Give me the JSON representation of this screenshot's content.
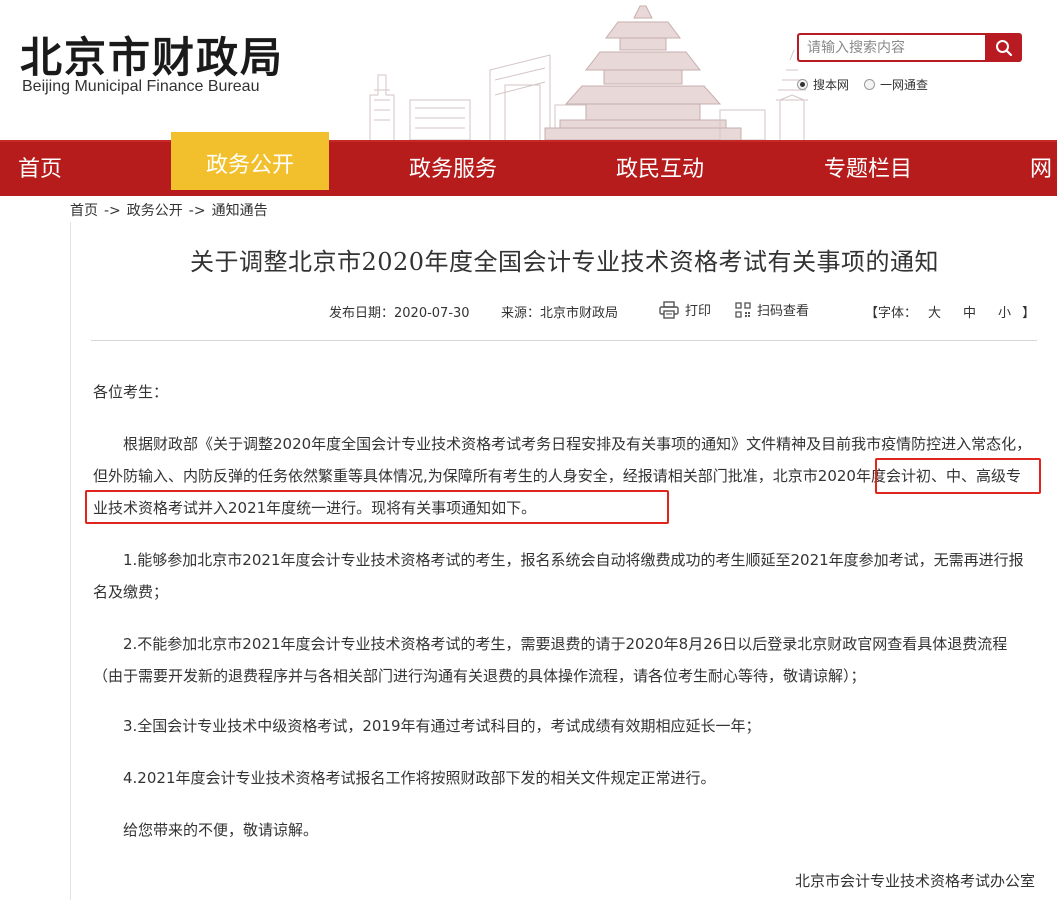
{
  "header": {
    "site_title": "北京市财政局",
    "site_subtitle": "Beijing Municipal Finance Bureau",
    "search_placeholder": "请输入搜索内容",
    "scope_options": [
      {
        "label": "搜本网",
        "selected": true
      },
      {
        "label": "一网通查",
        "selected": false
      }
    ],
    "brand_color": "#b71c1c",
    "active_tab_color": "#f2c02d"
  },
  "nav": {
    "items": [
      {
        "label": "首页",
        "active": false
      },
      {
        "label": "政务公开",
        "active": true
      },
      {
        "label": "政务服务",
        "active": false
      },
      {
        "label": "政民互动",
        "active": false
      },
      {
        "label": "专题栏目",
        "active": false
      },
      {
        "label": "网",
        "active": false
      }
    ]
  },
  "breadcrumb": {
    "items": [
      "首页",
      "政务公开",
      "通知通告"
    ],
    "separator": "->"
  },
  "article": {
    "title": "关于调整北京市2020年度全国会计专业技术资格考试有关事项的通知",
    "publish_date": "发布日期：2020-07-30",
    "source": "来源：北京市财政局",
    "print_label": "打印",
    "scan_label": "扫码查看",
    "font_size_label": "【字体：",
    "font_size_options": [
      "大",
      "中",
      "小"
    ],
    "font_size_close": "】",
    "greeting": "各位考生：",
    "paragraphs": [
      "根据财政部《关于调整2020年度全国会计专业技术资格考试考务日程安排及有关事项的通知》文件精神及目前我市疫情防控进入常态化，但外防输入、内防反弹的任务依然繁重等具体情况,为保障所有考生的人身安全，经报请相关部门批准，北京市2020年度会计初、中、高级专业技术资格考试并入2021年度统一进行。现将有关事项通知如下。",
      "1.能够参加北京市2021年度会计专业技术资格考试的考生，报名系统会自动将缴费成功的考生顺延至2021年度参加考试，无需再进行报名及缴费；",
      "2.不能参加北京市2021年度会计专业技术资格考试的考生，需要退费的请于2020年8月26日以后登录北京财政官网查看具体退费流程（由于需要开发新的退费程序并与各相关部门进行沟通有关退费的具体操作流程，请各位考生耐心等待，敬请谅解）；",
      "3.全国会计专业技术中级资格考试，2019年有通过考试科目的，考试成绩有效期相应延长一年；",
      "4.2021年度会计专业技术资格考试报名工作将按照财政部下发的相关文件规定正常进行。",
      "给您带来的不便，敬请谅解。"
    ],
    "signature": "北京市会计专业技术资格考试办公室",
    "highlight_color": "#e0251e"
  }
}
